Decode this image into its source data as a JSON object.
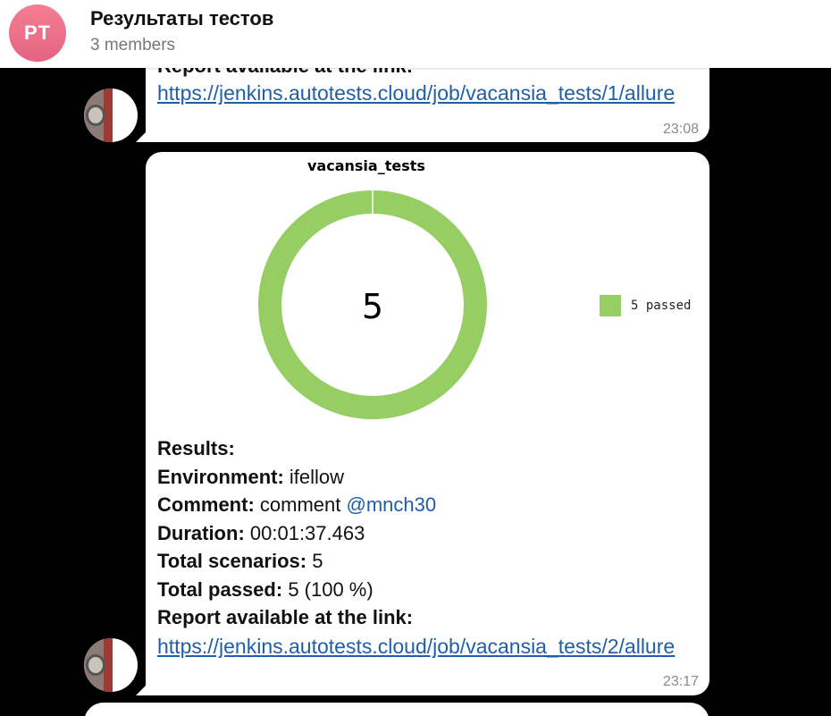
{
  "header": {
    "avatar_initials": "PT",
    "title": "Результаты тестов",
    "subtitle": "3 members"
  },
  "messages": [
    {
      "cut_text": "Report available at the link:",
      "link": "https://jenkins.autotests.cloud/job/vacansia_tests/1/allure",
      "time": "23:08"
    },
    {
      "link": "https://jenkins.autotests.cloud/job/vacansia_tests/2/allure",
      "time": "23:17",
      "results_heading": "Results:",
      "environment_label": "Environment:",
      "environment_value": "ifellow",
      "comment_label": "Comment:",
      "comment_value": "comment",
      "comment_mention": "@mnch30",
      "duration_label": "Duration:",
      "duration_value": "00:01:37.463",
      "scenarios_label": "Total scenarios:",
      "scenarios_value": "5",
      "passed_label": "Total passed:",
      "passed_value": "5 (100 %)",
      "report_label": "Report available at the link:"
    }
  ],
  "chart_data": {
    "type": "pie",
    "title": "vacansia_tests",
    "center_label": "5",
    "slices": [
      {
        "label": "5 passed",
        "value": 5,
        "color": "#96ce64"
      }
    ],
    "legend_position": "right"
  }
}
